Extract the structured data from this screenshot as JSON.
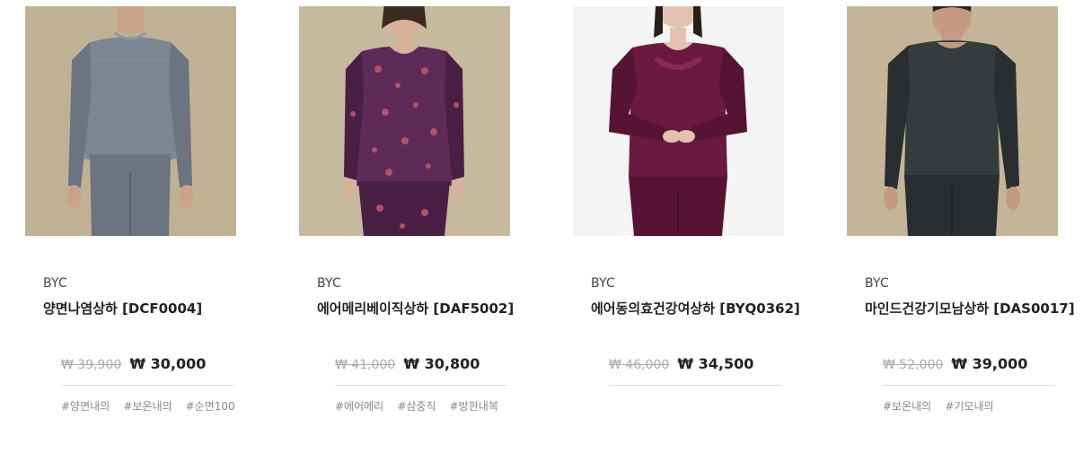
{
  "products": [
    {
      "brand": "BYC",
      "name": "양면나염상하 [DCF0004]",
      "original_price": "₩ 39,900",
      "sale_price": "₩ 30,000",
      "tags": [
        "#양면내의",
        "#보온내의",
        "#순면100"
      ],
      "image": {
        "bg": "#c4b598",
        "garment": "#7c8693",
        "garment_dark": "#6b7480",
        "skin": "#c9a389"
      }
    },
    {
      "brand": "BYC",
      "name": "에어메리베이직상하 [DAF5002]",
      "original_price": "₩ 41,000",
      "sale_price": "₩ 30,800",
      "tags": [
        "#에어메리",
        "#삼중직",
        "#방한내복"
      ],
      "image": {
        "bg": "#c7b99d",
        "garment": "#5e2a58",
        "garment_dark": "#4a1f46",
        "skin": "#d9b09a"
      }
    },
    {
      "brand": "BYC",
      "name": "에어동의효건강여상하 [BYQ0362]",
      "original_price": "₩ 46,000",
      "sale_price": "₩ 34,500",
      "tags": [],
      "image": {
        "bg": "#f4f4f4",
        "garment": "#6a1a3e",
        "garment_dark": "#571432",
        "skin": "#e3c2b1"
      }
    },
    {
      "brand": "BYC",
      "name": "마인드건강기모남상하 [DAS0017]",
      "original_price": "₩ 52,000",
      "sale_price": "₩ 39,000",
      "tags": [
        "#보온내의",
        "#기모내의"
      ],
      "image": {
        "bg": "#c4b598",
        "garment": "#363b3d",
        "garment_dark": "#2a2e30",
        "skin": "#c49a82"
      }
    }
  ]
}
